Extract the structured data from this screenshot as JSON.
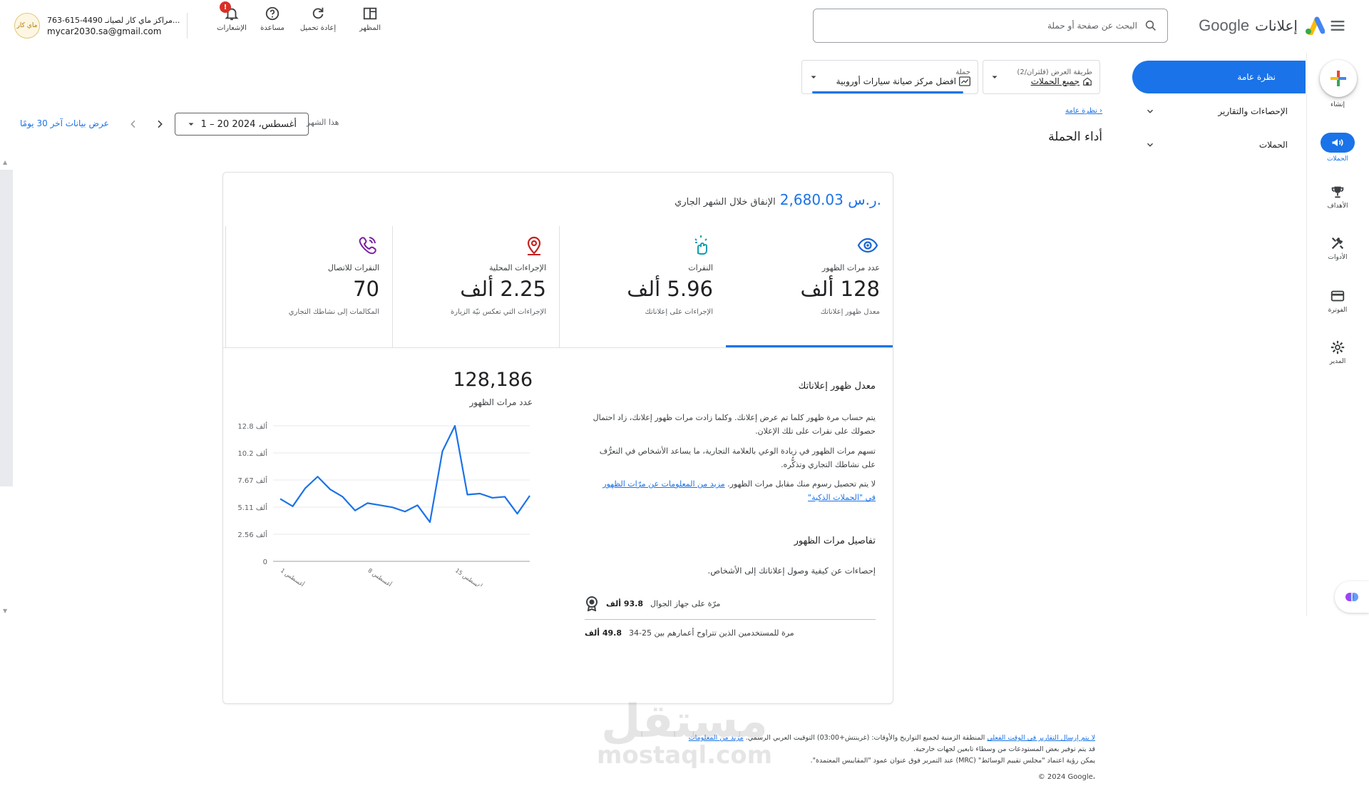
{
  "header": {
    "brand_google": "Google",
    "brand_product": "إعلانات",
    "search_placeholder": "البحث عن صفحة أو حملة",
    "tools": {
      "appearance": "المظهر",
      "reload": "إعادة تحميل",
      "help": "مساعدة",
      "notifications": "الإشعارات",
      "notifications_badge": "!"
    },
    "account": {
      "line1": "763-615-4490 مراكز ماي كار لصيانـ...",
      "email": "mycar2030.sa@gmail.com",
      "logo_text": "ماي كار"
    }
  },
  "rail": {
    "create": "إنشاء",
    "campaigns": "الحملات",
    "goals": "الأهداف",
    "tools": "الأدوات",
    "billing": "الفوترة",
    "admin": "المدير"
  },
  "nav": {
    "overview": "نظرة عامة",
    "insights_reports": "الإحصاءات والتقارير",
    "campaigns": "الحملات"
  },
  "selectors": {
    "view": {
      "label": "طريقة العرض (فلتران/2)",
      "value": "جميع الحملات"
    },
    "campaign": {
      "label": "حملة",
      "value": "افضل مركز صيانة سيارات أوروبية"
    }
  },
  "breadcrumb": "نظرة عامة ›",
  "page_title": "أداء الحملة",
  "date": {
    "label": "هذا الشهر",
    "range": "1 – 20 أغسطس، 2024",
    "last30": "عرض بيانات آخر 30 يومًا"
  },
  "card": {
    "spend_amount": "2,680.03 ر.س.",
    "spend_label": "الإنفاق خلال الشهر الجاري",
    "metrics": [
      {
        "name": "عدد مرات الظهور",
        "value": "128 ألف",
        "sub": "معدل ظهور إعلاناتك"
      },
      {
        "name": "النقرات",
        "value": "5.96 ألف",
        "sub": "الإجراءات على إعلاناتك"
      },
      {
        "name": "الإجراءات المحلية",
        "value": "2.25 ألف",
        "sub": "الإجراءات التي تعكس نيّة الزيارة"
      },
      {
        "name": "النقرات للاتصال",
        "value": "70",
        "sub": "المكالمات إلى نشاطك التجاري"
      }
    ],
    "detail": {
      "title": "معدل ظهور إعلاناتك",
      "p1": "يتم حساب مرة ظهور كلما تم عرض إعلانك. وكلما زادت مرات ظهور إعلانك، زاد احتمال حصولك على نقرات على تلك الإعلان.",
      "p2": "تسهم مرات الظهور في زيادة الوعي بالعلامة التجارية، ما يساعد الأشخاص في التعرُّف على نشاطك التجاري وتذكُّره.",
      "p3": "لا يتم تحصيل رسوم منك مقابل مرات الظهور.",
      "p3_link": "مزيد من المعلومات عن مرّات الظهور في \"الحملات الذكية\"",
      "breakdown_title": "تفاصيل مرات الظهور",
      "breakdown_sub": "إحصاءات عن كيفية وصول إعلاناتك إلى الأشخاص.",
      "rows": [
        {
          "value": "93.8 ألف",
          "text": "مرّة على جهاز الجوال"
        },
        {
          "value": "49.8 ألف",
          "text": "مرة للمستخدمين الذين تتراوح أعمارهم بين 25-34"
        }
      ]
    },
    "chart_total": "128,186",
    "chart_total_label": "عدد مرات الظهور"
  },
  "chart_data": {
    "type": "line",
    "ylabel": "",
    "y_ticks": [
      "12.8 ألف",
      "10.2 ألف",
      "7.67 ألف",
      "5.11 ألف",
      "2.56 ألف",
      "0"
    ],
    "ylim": [
      0,
      12800
    ],
    "x_ticks": [
      "1 أغسطس",
      "8 أغسطس",
      "15 أغسطس"
    ],
    "series": [
      {
        "values": [
          5900,
          5200,
          6900,
          8000,
          6800,
          6100,
          4800,
          5500,
          5300,
          5100,
          4700,
          5300,
          3700,
          10400,
          12800,
          6300,
          6400,
          6000,
          6100,
          4500,
          6200
        ]
      }
    ],
    "grid": true,
    "color": "#1a73e8"
  },
  "footer": {
    "line1_link": "لا يتم إرسال التقارير في الوقت الفعلي",
    "line1_text": "المنطقة الزمنية لجميع التواريخ والأوقات: (غرينتش+03:00) التوقيت العربي الرسمي.",
    "line1_more": "مزيد من المعلومات",
    "line2": "قد يتم توفير بعض المستودعات من وسطاء تابعين لجهات خارجية.",
    "line3": "يمكن رؤية اعتماد \"مجلس تقييم الوسائط\" (MRC) عند التمرير فوق عنوان عمود \"المقاييس المعتمدة\".",
    "copyright": "© 2024 Google،"
  },
  "watermark": {
    "line1": "مستقل",
    "line2": "mostaql.com"
  },
  "colors": {
    "accent": "#1a73e8",
    "text": "#202124",
    "muted": "#5f6368"
  }
}
